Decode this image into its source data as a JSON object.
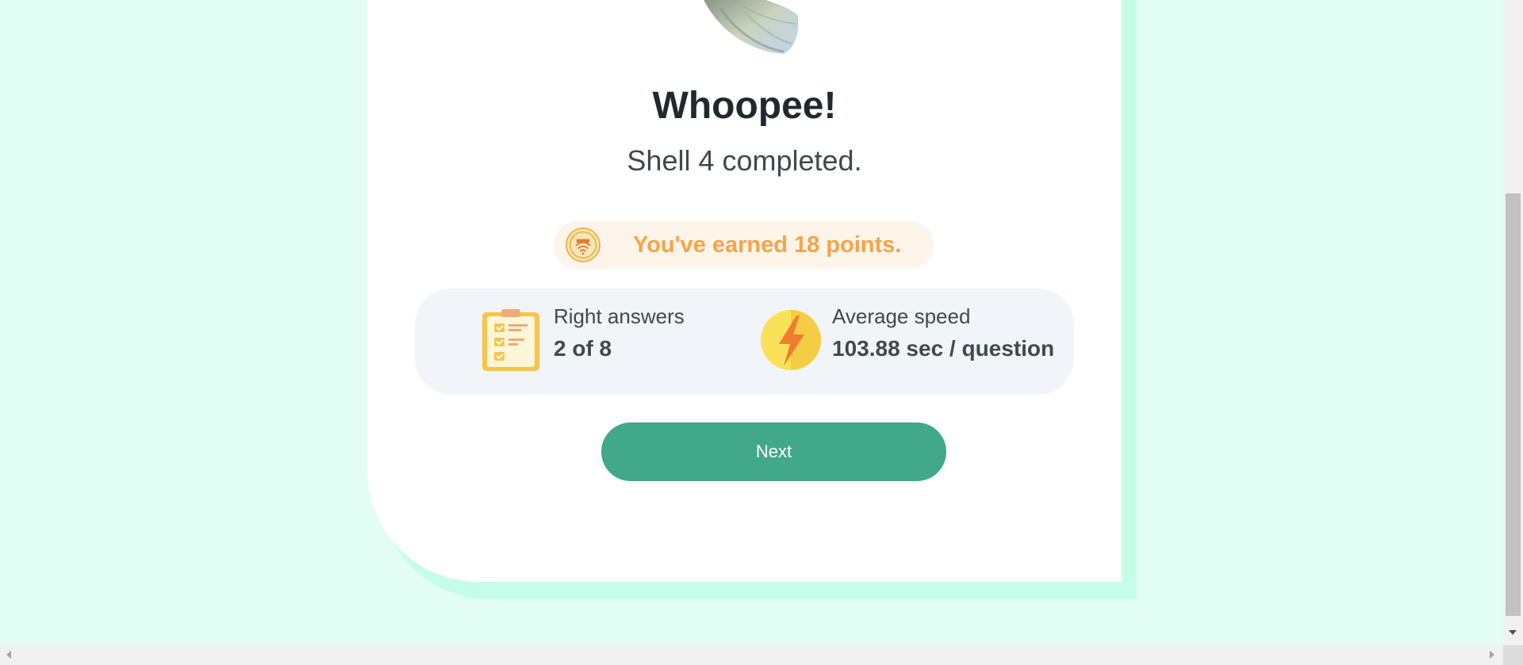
{
  "result": {
    "title": "Whoopee!",
    "subtitle": "Shell 4 completed.",
    "points_text": "You've earned 18 points."
  },
  "stats": {
    "right_answers": {
      "label": "Right answers",
      "value": "2 of 8",
      "icon": "clipboard-checklist-icon"
    },
    "average_speed": {
      "label": "Average speed",
      "value": "103.88 sec / question",
      "icon": "lightning-icon"
    }
  },
  "actions": {
    "next_label": "Next"
  },
  "colors": {
    "background": "#e2fdf3",
    "card_shadow": "#c4fde8",
    "points_text": "#f5a449",
    "points_bg": "#fff4ea",
    "button": "#42a88a",
    "stats_bg": "#f1f5f9"
  }
}
